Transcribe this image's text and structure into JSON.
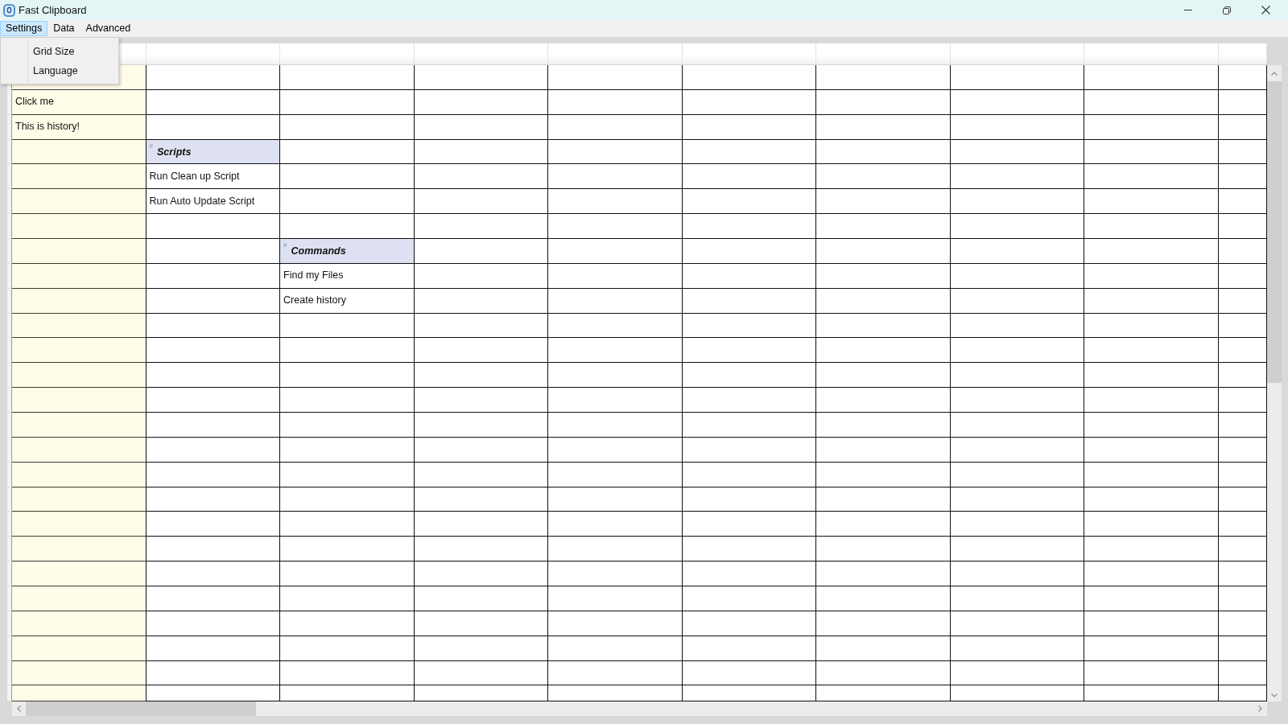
{
  "window": {
    "title": "Fast Clipboard"
  },
  "menu": [
    {
      "label": "Settings",
      "expanded": true,
      "items": [
        "Grid Size",
        "Language"
      ]
    },
    {
      "label": "Data",
      "expanded": false
    },
    {
      "label": "Advanced",
      "expanded": false
    }
  ],
  "history": {
    "items": [
      "Click me",
      "This is history!"
    ]
  },
  "groups": [
    {
      "marker": "#",
      "title": "Scripts",
      "items": [
        "Run Clean up Script",
        "Run Auto Update Script"
      ]
    },
    {
      "marker": "#",
      "title": "Commands",
      "items": [
        "Find my Files",
        "Create history"
      ]
    }
  ]
}
